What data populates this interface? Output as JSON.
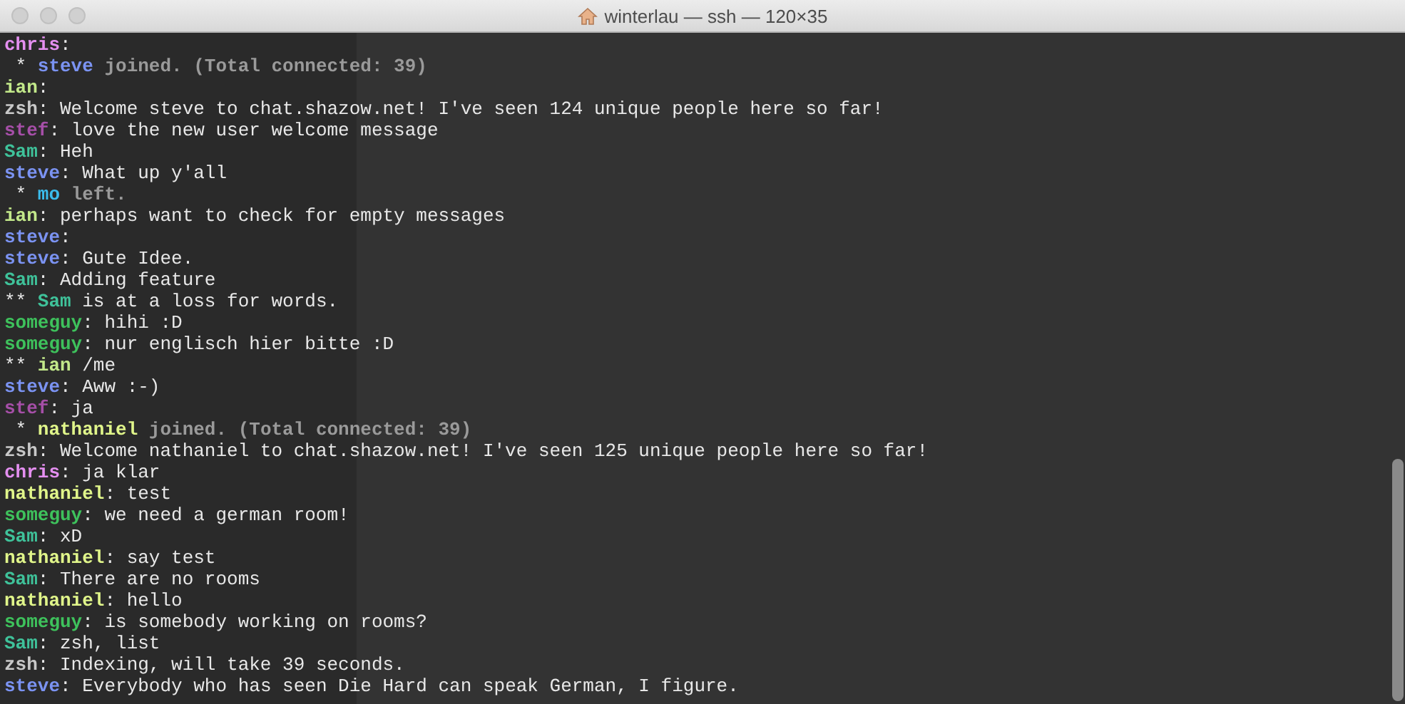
{
  "window": {
    "title": "winterlau — ssh — 120×35"
  },
  "lines": [
    {
      "kind": "message",
      "nick": "chris",
      "color": "#e48ff0",
      "text": ":"
    },
    {
      "kind": "event",
      "prefix": "*",
      "nick": "steve",
      "color": "#7b93f2",
      "text": "joined. (Total connected: 39)"
    },
    {
      "kind": "message",
      "nick": "ian",
      "color": "#c2e88a",
      "text": ":"
    },
    {
      "kind": "message",
      "nick": "zsh",
      "color": "#c8c8c8",
      "text": ": Welcome steve to chat.shazow.net! I've seen 124 unique people here so far!"
    },
    {
      "kind": "message",
      "nick": "stef",
      "color": "#a64fa8",
      "text": ": love the new user welcome message"
    },
    {
      "kind": "message",
      "nick": "Sam",
      "color": "#3fc29a",
      "text": ": Heh"
    },
    {
      "kind": "message",
      "nick": "steve",
      "color": "#7b93f2",
      "text": ": What up y'all"
    },
    {
      "kind": "event",
      "prefix": "*",
      "nick": "mo",
      "color": "#3bbcec",
      "text": "left."
    },
    {
      "kind": "message",
      "nick": "ian",
      "color": "#c2e88a",
      "text": ": perhaps want to check for empty messages"
    },
    {
      "kind": "message",
      "nick": "steve",
      "color": "#7b93f2",
      "text": ":"
    },
    {
      "kind": "message",
      "nick": "steve",
      "color": "#7b93f2",
      "text": ": Gute Idee."
    },
    {
      "kind": "message",
      "nick": "Sam",
      "color": "#3fc29a",
      "text": ": Adding feature"
    },
    {
      "kind": "action",
      "prefix": "**",
      "nick": "Sam",
      "color": "#3fc29a",
      "text": "is at a loss for words."
    },
    {
      "kind": "message",
      "nick": "someguy",
      "color": "#3ec25c",
      "text": ": hihi :D"
    },
    {
      "kind": "message",
      "nick": "someguy",
      "color": "#3ec25c",
      "text": ": nur englisch hier bitte :D"
    },
    {
      "kind": "action",
      "prefix": "**",
      "nick": "ian",
      "color": "#c2e88a",
      "text": "/me"
    },
    {
      "kind": "message",
      "nick": "steve",
      "color": "#7b93f2",
      "text": ": Aww :-)"
    },
    {
      "kind": "message",
      "nick": "stef",
      "color": "#a64fa8",
      "text": ": ja"
    },
    {
      "kind": "event",
      "prefix": "*",
      "nick": "nathaniel",
      "color": "#e0f58a",
      "text": "joined. (Total connected: 39)"
    },
    {
      "kind": "message",
      "nick": "zsh",
      "color": "#c8c8c8",
      "text": ": Welcome nathaniel to chat.shazow.net! I've seen 125 unique people here so far!"
    },
    {
      "kind": "message",
      "nick": "chris",
      "color": "#e48ff0",
      "text": ": ja klar"
    },
    {
      "kind": "message",
      "nick": "nathaniel",
      "color": "#e0f58a",
      "text": ": test"
    },
    {
      "kind": "message",
      "nick": "someguy",
      "color": "#3ec25c",
      "text": ": we need a german room!"
    },
    {
      "kind": "message",
      "nick": "Sam",
      "color": "#3fc29a",
      "text": ": xD"
    },
    {
      "kind": "message",
      "nick": "nathaniel",
      "color": "#e0f58a",
      "text": ": say test"
    },
    {
      "kind": "message",
      "nick": "Sam",
      "color": "#3fc29a",
      "text": ": There are no rooms"
    },
    {
      "kind": "message",
      "nick": "nathaniel",
      "color": "#e0f58a",
      "text": ": hello"
    },
    {
      "kind": "message",
      "nick": "someguy",
      "color": "#3ec25c",
      "text": ": is somebody working on rooms?"
    },
    {
      "kind": "message",
      "nick": "Sam",
      "color": "#3fc29a",
      "text": ": zsh, list"
    },
    {
      "kind": "message",
      "nick": "zsh",
      "color": "#c8c8c8",
      "text": ": Indexing, will take 39 seconds."
    },
    {
      "kind": "message",
      "nick": "steve",
      "color": "#7b93f2",
      "text": ": Everybody who has seen Die Hard can speak German, I figure."
    }
  ]
}
